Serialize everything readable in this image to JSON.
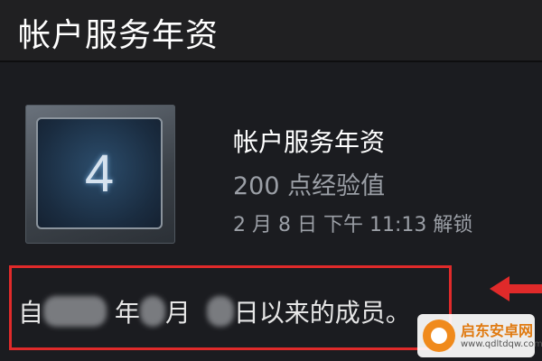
{
  "header": {
    "title": "帐户服务年资"
  },
  "achievement": {
    "badge_number": "4",
    "title": "帐户服务年资",
    "points": "200 点经验值",
    "unlock_time": "2 月 8 日 下午 11:13 解锁"
  },
  "member_since": {
    "part1": "自",
    "part2": "年",
    "part3": "月",
    "part4": "日以来的成员。"
  },
  "annotation": {
    "highlight_color": "#e02a2a"
  },
  "watermark": {
    "title": "启东安卓网",
    "url": "www.qdltdqw.com"
  }
}
